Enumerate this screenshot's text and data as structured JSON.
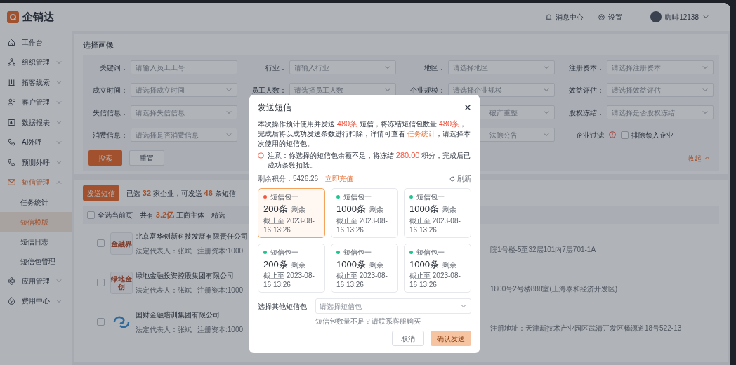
{
  "brand": {
    "name": "企销达"
  },
  "header": {
    "items": [
      {
        "kind": "bell",
        "label": "消息中心"
      },
      {
        "kind": "gear",
        "label": "设置"
      }
    ],
    "user": "咖啡12138"
  },
  "sidebar": {
    "items": [
      {
        "kind": "home",
        "label": "工作台",
        "selected": false
      },
      {
        "kind": "org",
        "label": "组织管理",
        "selected": false,
        "expanded": false
      },
      {
        "kind": "clue",
        "label": "拓客线索",
        "selected": false,
        "expanded": false
      },
      {
        "kind": "people",
        "label": "客户管理",
        "selected": false,
        "expanded": false
      },
      {
        "kind": "chart",
        "label": "数据报表",
        "selected": false,
        "expanded": false
      },
      {
        "kind": "phone",
        "label": "AI外呼",
        "selected": false,
        "expanded": false
      },
      {
        "kind": "phone",
        "label": "预测外呼",
        "selected": false,
        "expanded": false
      },
      {
        "kind": "mail",
        "label": "短信管理",
        "selected": true,
        "expanded": true,
        "children": [
          {
            "label": "任务统计",
            "selected": false
          },
          {
            "label": "短信模版",
            "selected": true
          },
          {
            "label": "短信日志",
            "selected": false
          },
          {
            "label": "短信包管理",
            "selected": false
          }
        ]
      },
      {
        "kind": "app",
        "label": "应用管理",
        "selected": false,
        "expanded": false
      },
      {
        "kind": "fee",
        "label": "费用中心",
        "selected": false,
        "expanded": false
      }
    ]
  },
  "filters": {
    "title": "选择画像",
    "rows": [
      [
        {
          "label": "关键词：",
          "placeholder": "请输入员工工号",
          "kind": "input"
        },
        {
          "label": "行业：",
          "placeholder": "请输入行业",
          "kind": "select"
        },
        {
          "label": "地区：",
          "placeholder": "请选择地区",
          "kind": "select"
        },
        {
          "label": "注册资本：",
          "placeholder": "请选择注册资本",
          "kind": "select"
        }
      ],
      [
        {
          "label": "成立时间：",
          "placeholder": "请选择成立时间",
          "kind": "select"
        },
        {
          "label": "员工人数：",
          "placeholder": "请选择员工人数",
          "kind": "select"
        },
        {
          "label": "企业规模：",
          "placeholder": "请选择企业规模",
          "kind": "select"
        },
        {
          "label": "效益评估：",
          "placeholder": "请选择效益评估",
          "kind": "select"
        }
      ],
      [
        {
          "label": "失信信息：",
          "placeholder": "请选择失信信息",
          "kind": "select"
        },
        {
          "kind": "hidden"
        },
        {
          "placeholder": "破产重整",
          "kind": "partial"
        },
        {
          "label": "股权冻结：",
          "placeholder": "请选择是否股权冻结",
          "kind": "select"
        }
      ],
      [
        {
          "label": "消费信息：",
          "placeholder": "请选择是否消费信息",
          "kind": "select"
        },
        {
          "kind": "hidden"
        },
        {
          "placeholder": "法除公告",
          "kind": "partial"
        },
        {
          "label": "企业过滤",
          "kind": "checkbox",
          "checked": false,
          "option": "排除禁入企业"
        }
      ]
    ],
    "buttons": [
      "搜索",
      "重置"
    ],
    "collapse": "收起"
  },
  "list": {
    "send_button": "发送短信",
    "summary": [
      {
        "kind": "text",
        "text": "已选 "
      },
      {
        "kind": "num",
        "text": "32"
      },
      {
        "kind": "text",
        "text": " 家企业，可发送 "
      },
      {
        "kind": "num",
        "text": "46"
      },
      {
        "kind": "text",
        "text": " 条短信"
      }
    ],
    "select_all": {
      "label": "全选当前页",
      "checked": false
    },
    "totals": [
      {
        "kind": "text",
        "text": "共有 "
      },
      {
        "kind": "num",
        "text": "3.2亿"
      },
      {
        "kind": "text",
        "text": " 工商主体　精选"
      }
    ],
    "companies": [
      {
        "logo": "金融界",
        "name": "北京富华创新科技发展有限责任公司",
        "legal": "法定代表人：张斌",
        "capital": "注册资本:1000",
        "address": "院1号楼-5至32层101内7层701-1A",
        "checked": false
      },
      {
        "logo": "绿地金创",
        "name": "绿地金融投资控股集团有限公司",
        "legal": "法定代表人：张斌",
        "capital": "注册资本:1000",
        "address": "1800号2号楼888室(上海泰和经济开发区)",
        "checked": false
      },
      {
        "name": "国财金融培训集团有限公司",
        "legal": "法定代表人：张斌",
        "capital": "注册资本:1000",
        "address": "注册地址：天津新技术产业园区武清开发区畅源道18号522-13",
        "checked": false
      }
    ]
  },
  "modal": {
    "title": "发送短信",
    "message": [
      {
        "kind": "text",
        "text": "本次操作预计使用并发送 "
      },
      {
        "kind": "num",
        "text": "480条"
      },
      {
        "kind": "text",
        "text": " 短信，将冻结短信包数量 "
      },
      {
        "kind": "num",
        "text": "480条"
      },
      {
        "kind": "text",
        "text": "，完成后将以成功发送条数进行扣除，详情可查看 "
      },
      {
        "kind": "link",
        "text": "任务统计"
      },
      {
        "kind": "text",
        "text": "，请选择本次使用的短信包。"
      }
    ],
    "notice": [
      {
        "kind": "text",
        "text": "注意：你选择的短信包余额不足，将冻结 "
      },
      {
        "kind": "num",
        "text": "280.00"
      },
      {
        "kind": "text",
        "text": " 积分，完成后已成功条数扣除。"
      }
    ],
    "balance": "剩余积分：5426.26",
    "recharge": "立即充值",
    "refresh": "刷新",
    "packages": [
      {
        "name": "短信包一",
        "color": "#f5533d",
        "amount": "200条",
        "remain": "剩余",
        "expiry": "截止至 2023-08-16 13:26",
        "selected": true
      },
      {
        "name": "短信包一",
        "color": "#1fc48e",
        "amount": "1000条",
        "remain": "剩余",
        "expiry": "截止至 2023-08-16 13:26",
        "selected": false
      },
      {
        "name": "短信包一",
        "color": "#1fc48e",
        "amount": "1000条",
        "remain": "剩余",
        "expiry": "截止至 2023-08-16 13:26",
        "selected": false
      },
      {
        "name": "短信包一",
        "color": "#1fc48e",
        "amount": "200条",
        "remain": "剩余",
        "expiry": "截止至 2023-08-16 13:26",
        "selected": false
      },
      {
        "name": "短信包一",
        "color": "#1fc48e",
        "amount": "1000条",
        "remain": "剩余",
        "expiry": "截止至 2023-08-16 13:26",
        "selected": false
      },
      {
        "name": "短信包一",
        "color": "#1fc48e",
        "amount": "1000条",
        "remain": "剩余",
        "expiry": "截止至 2023-08-16 13:26",
        "selected": false
      }
    ],
    "other_label": "选择其他短信包",
    "other_placeholder": "请选择短信包",
    "hint": "短信包数量不足？请联系客服购买",
    "cancel": "取消",
    "confirm": "确认发送",
    "confirm_disabled": true
  }
}
